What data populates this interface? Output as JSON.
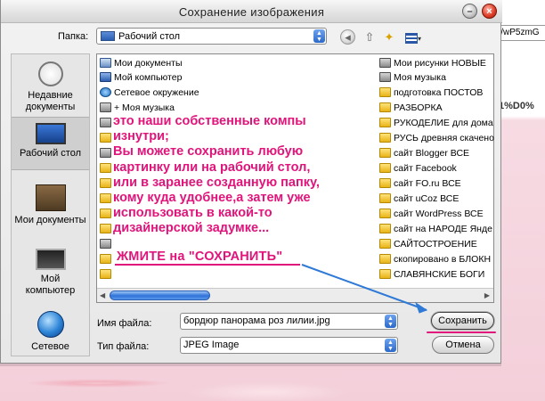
{
  "window": {
    "title": "Сохранение изображения"
  },
  "background": {
    "url_fragment": "i/wP5zmG",
    "percent_text": "1%D0%"
  },
  "toolbar": {
    "folder_label": "Папка:",
    "folder_value": "Рабочий стол"
  },
  "places": [
    {
      "label": "Недавние документы",
      "icon": "recent-documents-icon"
    },
    {
      "label": "Рабочий стол",
      "icon": "desktop-icon",
      "selected": true
    },
    {
      "label": "Мои документы",
      "icon": "my-documents-icon"
    },
    {
      "label": "Мой компьютер",
      "icon": "my-computer-icon"
    },
    {
      "label": "Сетевое",
      "icon": "network-icon"
    }
  ],
  "files_left": [
    {
      "name": "Мои документы",
      "icon": "doc"
    },
    {
      "name": "Мой компьютер",
      "icon": "pc"
    },
    {
      "name": "Сетевое окружение",
      "icon": "net"
    },
    {
      "name": "+ Моя музыка",
      "icon": "music"
    }
  ],
  "files_right": [
    {
      "name": "Мои рисунки НОВЫЕ",
      "icon": "music"
    },
    {
      "name": "Моя музыка",
      "icon": "music"
    },
    {
      "name": "подготовка ПОСТОВ",
      "icon": "folder"
    },
    {
      "name": "РАЗБОРКА",
      "icon": "folder"
    },
    {
      "name": "РУКОДЕЛИЕ для дома",
      "icon": "folder"
    },
    {
      "name": "РУСЬ древняя скачено",
      "icon": "folder"
    },
    {
      "name": "сайт Blogger ВСЕ",
      "icon": "folder"
    },
    {
      "name": "сайт Facebook",
      "icon": "folder"
    },
    {
      "name": "сайт FO.ru ВСЕ",
      "icon": "folder"
    },
    {
      "name": "сайт uCoz ВСЕ",
      "icon": "folder"
    },
    {
      "name": "сайт WordPress ВСЕ",
      "icon": "folder"
    },
    {
      "name": "сайт на НАРОДЕ Янде",
      "icon": "folder"
    },
    {
      "name": "САЙТОСТРОЕНИЕ",
      "icon": "folder"
    },
    {
      "name": "скопировано в БЛОКН",
      "icon": "folder"
    },
    {
      "name": "СЛАВЯНСКИЕ БОГИ",
      "icon": "folder"
    }
  ],
  "annotation": {
    "lines": [
      "это наши собственные компы",
      "изнутри;",
      "Вы можете сохранить любую",
      "картинку или на рабочий стол,",
      "или в заранее созданную папку,",
      "кому куда удобнее,а затем уже",
      "использовать в какой-то",
      "дизайнерской задумке..."
    ],
    "call_to_action": "ЖМИТЕ на \"СОХРАНИТЬ\"",
    "color": "#e0147a"
  },
  "form": {
    "filename_label": "Имя файла:",
    "filename_value": "бордюр панорама роз лилии.jpg",
    "filetype_label": "Тип файла:",
    "filetype_value": "JPEG Image",
    "save_label": "Сохранить",
    "cancel_label": "Отмена"
  }
}
